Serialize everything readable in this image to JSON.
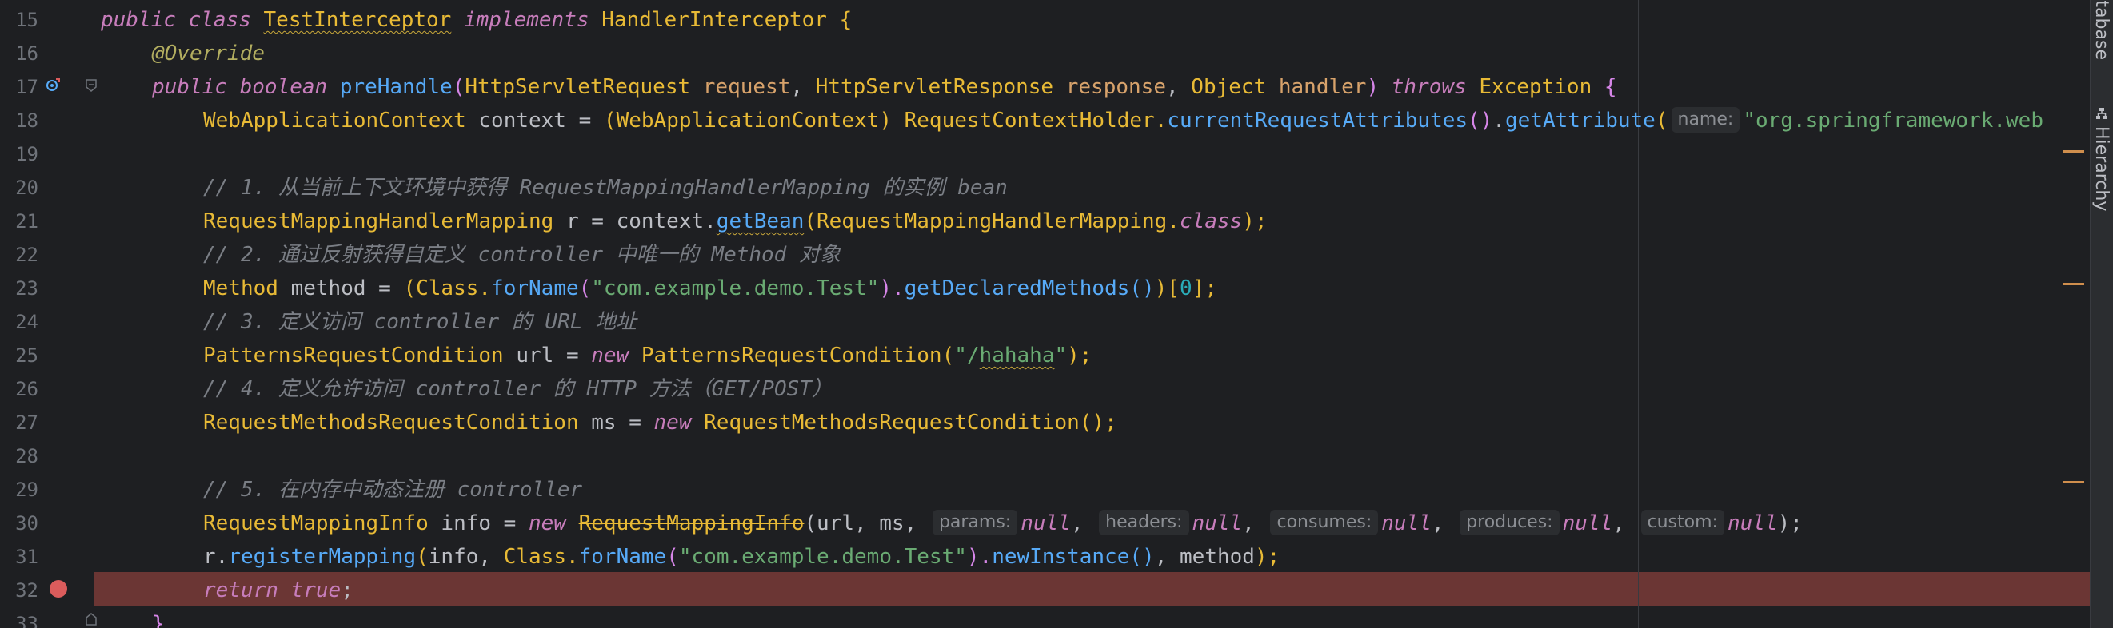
{
  "editor": {
    "line_numbers": [
      "15",
      "16",
      "17",
      "18",
      "19",
      "20",
      "21",
      "22",
      "23",
      "24",
      "25",
      "26",
      "27",
      "28",
      "29",
      "30",
      "31",
      "32",
      "33"
    ],
    "lines": {
      "l15": {
        "kw1": "public",
        "kw2": "class",
        "cls": "TestInterceptor",
        "kw3": "implements",
        "iface": "HandlerInterceptor",
        "brace": "{"
      },
      "l16": {
        "ann": "@Override"
      },
      "l17": {
        "kw1": "public",
        "kw2": "boolean",
        "fn": "preHandle",
        "p_open": "(",
        "t1": "HttpServletRequest",
        "n1": "request",
        ",1": ",",
        "t2": "HttpServletResponse",
        "n2": "response",
        ",2": ",",
        "t3": "Object",
        "n3": "handler",
        "p_close": ")",
        "kw3": "throws",
        "exc": "Exception",
        "brace": "{"
      },
      "l18": {
        "type": "WebApplicationContext",
        "rest1": " context = ",
        "cast_open": "(",
        "cast": "WebApplicationContext",
        "cast_close": ")",
        "holder": " RequestContextHolder.",
        "fn1": "currentRequestAttributes",
        "call1": "()",
        "dot": ".",
        "fn2": "getAttribute",
        "p2": "(",
        "hint": "name:",
        "str": "\"org.springframework.web"
      },
      "l20": {
        "comment": "// 1. 从当前上下文环境中获得 RequestMappingHandlerMapping 的实例 bean"
      },
      "l21": {
        "type": "RequestMappingHandlerMapping",
        "rest": " r = context.",
        "fn": "getBean",
        "p": "(",
        "cls": "RequestMappingHandlerMapping.",
        "kw": "class",
        "close": ");"
      },
      "l22": {
        "comment": "// 2. 通过反射获得自定义 controller 中唯一的 Method 对象"
      },
      "l23": {
        "type": "Method",
        "rest": " method = ",
        "p1": "(",
        "cls": "Class.",
        "fn1": "forName",
        "p2": "(",
        "str": "\"com.example.demo.Test\"",
        "p3": ").",
        "fn2": "getDeclaredMethods",
        "p4": "()",
        "p5": ")",
        "idx_open": "[",
        "idx": "0",
        "idx_close": "];"
      },
      "l24": {
        "comment": "// 3. 定义访问 controller 的 URL 地址"
      },
      "l25": {
        "type": "PatternsRequestCondition",
        "rest": " url = ",
        "kw": "new",
        "cls": " PatternsRequestCondition",
        "p": "(",
        "str1": "\"/",
        "str2": "hahaha",
        "str3": "\"",
        "close": ");"
      },
      "l26": {
        "comment": "// 4. 定义允许访问 controller 的 HTTP 方法（GET/POST）"
      },
      "l27": {
        "type": "RequestMethodsRequestCondition",
        "rest": " ms = ",
        "kw": "new",
        "cls": " RequestMethodsRequestCondition",
        "close": "();"
      },
      "l29": {
        "comment": "// 5. 在内存中动态注册 controller"
      },
      "l30": {
        "type": "RequestMappingInfo",
        "rest": " info = ",
        "kw": "new",
        "cls": "RequestMappingInfo",
        "args": "(url, ms, ",
        "h1": "params:",
        "v1": "null",
        ",1": ", ",
        "h2": "headers:",
        "v2": "null",
        ",2": ", ",
        "h3": "consumes:",
        "v3": "null",
        ",3": ", ",
        "h4": "produces:",
        "v4": "null",
        ",4": ", ",
        "h5": "custom:",
        "v5": "null",
        "close": ");"
      },
      "l31": {
        "pre": "r.",
        "fn1": "registerMapping",
        "p1": "(",
        "args1": "info, ",
        "cls": "Class.",
        "fn2": "forName",
        "p2": "(",
        "str": "\"com.example.demo.Test\"",
        "p3": ").",
        "fn3": "newInstance",
        "p4": "()",
        "args2": ", method",
        "close": ");"
      },
      "l32": {
        "kw1": "return",
        "kw2": "true",
        "semi": ";"
      },
      "l33": {
        "brace": "}"
      }
    }
  },
  "right_sidebar": {
    "tab_database": "Database",
    "tab_hierarchy": "Hierarchy"
  },
  "colors": {
    "background": "#1e1f22",
    "breakpoint_line": "#6b3634",
    "breakpoint_dot": "#db5c5c",
    "keyword": "#c77dbb",
    "type": "#e8ba36",
    "string": "#6aab73",
    "comment": "#7a7e85"
  }
}
